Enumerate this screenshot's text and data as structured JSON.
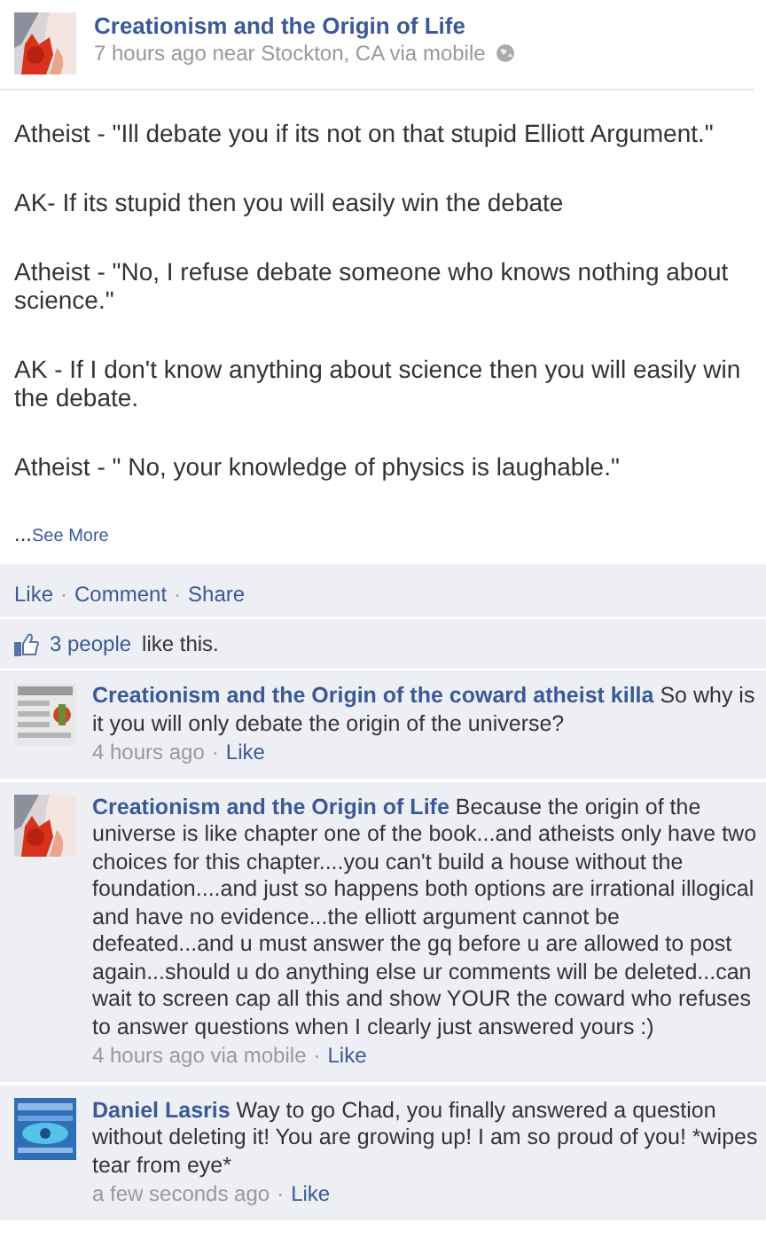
{
  "post": {
    "author": "Creationism and the Origin of Life",
    "meta": "7 hours ago near Stockton, CA via mobile",
    "paragraphs": [
      "Atheist - \"Ill debate you if its not on that stupid Elliott Argument.\"",
      "AK- If its stupid then you will easily win the debate",
      "Atheist - \"No, I refuse debate someone who knows nothing about science.\"",
      "AK - If I don't know anything about science then you will easily win the debate.",
      "Atheist - \" No, your knowledge of physics is laughable.\""
    ],
    "ellipsis": "...",
    "see_more": "See More"
  },
  "actions": [
    {
      "kind": "link",
      "text": "Like"
    },
    {
      "kind": "separator",
      "text": "·"
    },
    {
      "kind": "link",
      "text": "Comment"
    },
    {
      "kind": "separator",
      "text": "·"
    },
    {
      "kind": "link",
      "text": "Share"
    }
  ],
  "likes": {
    "count": "3 people",
    "text": "like this."
  },
  "comments": [
    {
      "author": "Creationism and the Origin of the coward atheist killa",
      "text": "So why is it you will only debate the origin of the universe?",
      "time": "4 hours ago",
      "dot": "·",
      "like": "Like"
    },
    {
      "author": "Creationism and the Origin of Life",
      "text": "Because the origin of the universe is like chapter one of the book...and atheists only have two choices for this chapter....you can't build a house without the foundation....and just so happens both options are irrational illogical and have no evidence...the elliott argument cannot be defeated...and u must answer the gq before u are allowed to post again...should u do anything else ur comments will be deleted...can wait to screen cap all this and show YOUR the coward who refuses to answer questions when I clearly just answered yours :)",
      "time": "4 hours ago via mobile",
      "dot": "·",
      "like": "Like"
    },
    {
      "author": "Daniel Lasris",
      "text": "Way to go Chad, you finally answered a question without deleting it! You are growing up! I am so proud of you! *wipes tear from eye*",
      "time": "a few seconds ago",
      "dot": "·",
      "like": "Like"
    }
  ]
}
